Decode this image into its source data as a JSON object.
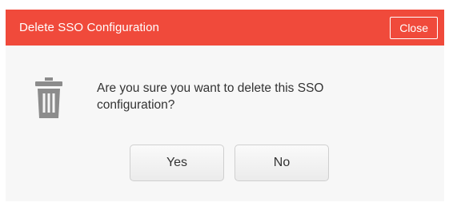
{
  "dialog": {
    "title": "Delete SSO Configuration",
    "close_label": "Close",
    "message": "Are you sure you want to delete this SSO configuration?",
    "yes_label": "Yes",
    "no_label": "No",
    "icon": "trash-icon"
  },
  "colors": {
    "header": "#f04a3b",
    "header_text": "#ffffff",
    "body_background": "#f7f7f7",
    "icon": "#8c8c8c",
    "text": "#333333"
  }
}
